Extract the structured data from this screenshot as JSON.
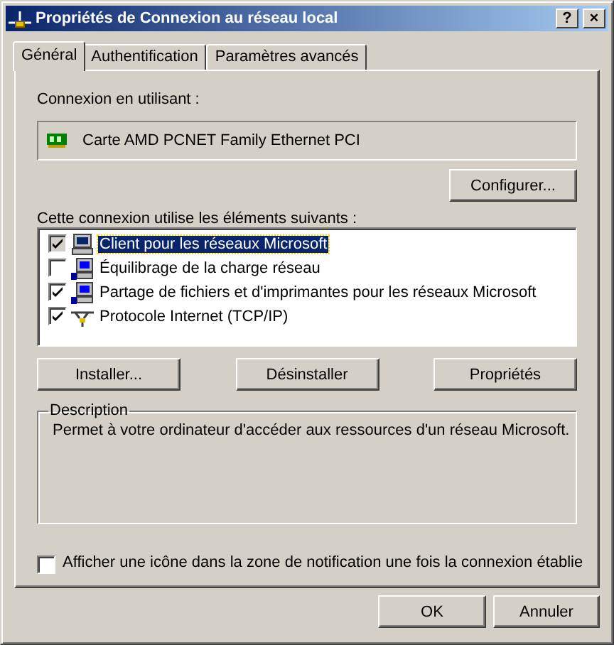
{
  "window": {
    "title": "Propriétés de Connexion au réseau local",
    "help": "?",
    "close": "×"
  },
  "tabs": [
    {
      "label": "Général",
      "selected": true
    },
    {
      "label": "Authentification",
      "selected": false
    },
    {
      "label": "Paramètres avancés",
      "selected": false
    }
  ],
  "adapter": {
    "label": "Connexion en utilisant :",
    "value": "Carte AMD PCNET Family Ethernet PCI",
    "button": "Configurer..."
  },
  "components": {
    "label": "Cette connexion utilise les éléments suivants :",
    "items": [
      {
        "label": "Client pour les réseaux Microsoft",
        "checked": true,
        "selected": true,
        "kind": "client"
      },
      {
        "label": "Équilibrage de la charge réseau",
        "checked": false,
        "selected": false,
        "kind": "service"
      },
      {
        "label": "Partage de fichiers et d'imprimantes pour les réseaux Microsoft",
        "checked": true,
        "selected": false,
        "kind": "service"
      },
      {
        "label": "Protocole Internet (TCP/IP)",
        "checked": true,
        "selected": false,
        "kind": "protocol"
      }
    ],
    "buttons": [
      "Installer...",
      "Désinstaller",
      "Propriétés"
    ]
  },
  "description": {
    "title": "Description",
    "text": "Permet à votre ordinateur d'accéder aux ressources d'un réseau Microsoft."
  },
  "notify": {
    "label": "Afficher une icône dans la zone de notification une fois la connexion établie",
    "checked": false
  },
  "buttons": [
    "OK",
    "Annuler"
  ]
}
